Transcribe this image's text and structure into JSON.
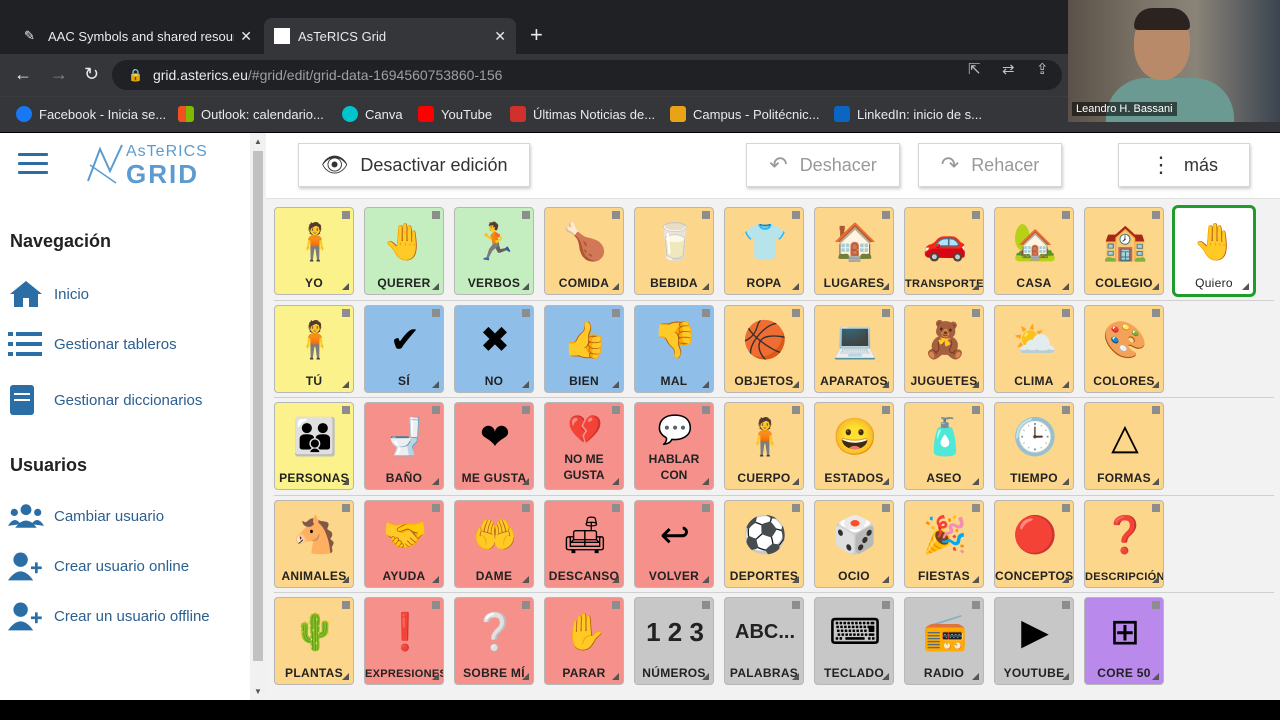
{
  "browser": {
    "tabs": [
      {
        "title": "AAC Symbols and shared resour",
        "active": false
      },
      {
        "title": "AsTeRICS Grid",
        "active": true
      }
    ],
    "url_domain": "grid.asterics.eu",
    "url_path": "/#grid/edit/grid-data-1694560753860-156",
    "bookmarks": [
      {
        "label": "Facebook - Inicia se...",
        "color": "#1877f2"
      },
      {
        "label": "Outlook: calendario...",
        "color": "#f25022"
      },
      {
        "label": "Canva",
        "color": "#00c4cc"
      },
      {
        "label": "YouTube",
        "color": "#ff0000"
      },
      {
        "label": "Últimas Noticias de...",
        "color": "#d0312d"
      },
      {
        "label": "Campus - Politécnic...",
        "color": "#e8a317"
      },
      {
        "label": "LinkedIn: inicio de s...",
        "color": "#0a66c2"
      }
    ]
  },
  "webcam": {
    "name": "Leandro H. Bassani"
  },
  "logo": {
    "line1": "AsTeRICS",
    "line2": "GRID"
  },
  "sidebar": {
    "nav_heading": "Navegación",
    "nav_items": [
      {
        "label": "Inicio",
        "icon": "home-icon"
      },
      {
        "label": "Gestionar tableros",
        "icon": "list-icon"
      },
      {
        "label": "Gestionar diccionarios",
        "icon": "book-icon"
      }
    ],
    "users_heading": "Usuarios",
    "user_items": [
      {
        "label": "Cambiar usuario",
        "icon": "users-icon"
      },
      {
        "label": "Crear usuario online",
        "icon": "user-plus-icon"
      },
      {
        "label": "Crear un usuario offline",
        "icon": "user-plus-icon"
      }
    ]
  },
  "toolbar": {
    "edit_label": "Desactivar edición",
    "undo_label": "Deshacer",
    "redo_label": "Rehacer",
    "more_label": "más"
  },
  "grid": {
    "colors": {
      "yellow": "#fbf28b",
      "green": "#c4eec0",
      "orange": "#fcd68a",
      "blue": "#8fbfe9",
      "red": "#f5908a",
      "gray": "#c7c7c7",
      "purple": "#b989ec"
    },
    "rows": [
      [
        {
          "label": "YO",
          "color": "yellow",
          "glyph": "🧍"
        },
        {
          "label": "QUERER",
          "color": "green",
          "glyph": "🤚"
        },
        {
          "label": "VERBOS",
          "color": "green",
          "glyph": "🏃"
        },
        {
          "label": "COMIDA",
          "color": "orange",
          "glyph": "🍗"
        },
        {
          "label": "BEBIDA",
          "color": "orange",
          "glyph": "🥛"
        },
        {
          "label": "ROPA",
          "color": "orange",
          "glyph": "👕"
        },
        {
          "label": "LUGARES",
          "color": "orange",
          "glyph": "🏠"
        },
        {
          "label": "TRANSPORTE",
          "color": "orange",
          "glyph": "🚗"
        },
        {
          "label": "CASA",
          "color": "orange",
          "glyph": "🏡"
        },
        {
          "label": "COLEGIO",
          "color": "orange",
          "glyph": "🏫"
        },
        {
          "label": "Quiero",
          "color": "white",
          "glyph": "🤚",
          "selected": true
        }
      ],
      [
        {
          "label": "TÚ",
          "color": "yellow",
          "glyph": "🧍"
        },
        {
          "label": "SÍ",
          "color": "blue",
          "glyph": "✔"
        },
        {
          "label": "NO",
          "color": "blue",
          "glyph": "✖"
        },
        {
          "label": "BIEN",
          "color": "blue",
          "glyph": "👍"
        },
        {
          "label": "MAL",
          "color": "blue",
          "glyph": "👎"
        },
        {
          "label": "OBJETOS",
          "color": "orange",
          "glyph": "🏀"
        },
        {
          "label": "APARATOS",
          "color": "orange",
          "glyph": "💻"
        },
        {
          "label": "JUGUETES",
          "color": "orange",
          "glyph": "🧸"
        },
        {
          "label": "CLIMA",
          "color": "orange",
          "glyph": "⛅"
        },
        {
          "label": "COLORES",
          "color": "orange",
          "glyph": "🎨"
        }
      ],
      [
        {
          "label": "PERSONAS",
          "color": "yellow",
          "glyph": "👪"
        },
        {
          "label": "BAÑO",
          "color": "red",
          "glyph": "🚽"
        },
        {
          "label": "ME GUSTA",
          "color": "red",
          "glyph": "❤"
        },
        {
          "label": "NO ME GUSTA",
          "color": "red",
          "glyph": "💔",
          "two_line": [
            "NO ME",
            "GUSTA"
          ]
        },
        {
          "label": "HABLAR CON",
          "color": "red",
          "glyph": "💬",
          "two_line": [
            "HABLAR",
            "CON"
          ]
        },
        {
          "label": "CUERPO",
          "color": "orange",
          "glyph": "🧍"
        },
        {
          "label": "ESTADOS",
          "color": "orange",
          "glyph": "😀"
        },
        {
          "label": "ASEO",
          "color": "orange",
          "glyph": "🧴"
        },
        {
          "label": "TIEMPO",
          "color": "orange",
          "glyph": "🕒"
        },
        {
          "label": "FORMAS",
          "color": "orange",
          "glyph": "△"
        }
      ],
      [
        {
          "label": "ANIMALES",
          "color": "orange",
          "glyph": "🐴"
        },
        {
          "label": "AYUDA",
          "color": "red",
          "glyph": "🤝"
        },
        {
          "label": "DAME",
          "color": "red",
          "glyph": "🤲"
        },
        {
          "label": "DESCANSO",
          "color": "red",
          "glyph": "🛋"
        },
        {
          "label": "VOLVER",
          "color": "red",
          "glyph": "↩"
        },
        {
          "label": "DEPORTES",
          "color": "orange",
          "glyph": "⚽"
        },
        {
          "label": "OCIO",
          "color": "orange",
          "glyph": "🎲"
        },
        {
          "label": "FIESTAS",
          "color": "orange",
          "glyph": "🎉"
        },
        {
          "label": "CONCEPTOS",
          "color": "orange",
          "glyph": "🔴"
        },
        {
          "label": "DESCRIPCIÓN",
          "color": "orange",
          "glyph": "❓"
        }
      ],
      [
        {
          "label": "PLANTAS",
          "color": "orange",
          "glyph": "🌵"
        },
        {
          "label": "EXPRESIONES",
          "color": "red",
          "glyph": "❗"
        },
        {
          "label": "SOBRE MÍ",
          "color": "red",
          "glyph": "❔"
        },
        {
          "label": "PARAR",
          "color": "red",
          "glyph": "✋"
        },
        {
          "label": "NÚMEROS",
          "color": "gray",
          "text_glyph": "1 2 3"
        },
        {
          "label": "PALABRAS",
          "color": "gray",
          "text_glyph": "ABC..."
        },
        {
          "label": "TECLADO",
          "color": "gray",
          "glyph": "⌨"
        },
        {
          "label": "RADIO",
          "color": "gray",
          "glyph": "📻"
        },
        {
          "label": "YOUTUBE",
          "color": "gray",
          "glyph": "▶"
        },
        {
          "label": "CORE 50",
          "color": "purple",
          "glyph": "⊞"
        }
      ]
    ]
  }
}
